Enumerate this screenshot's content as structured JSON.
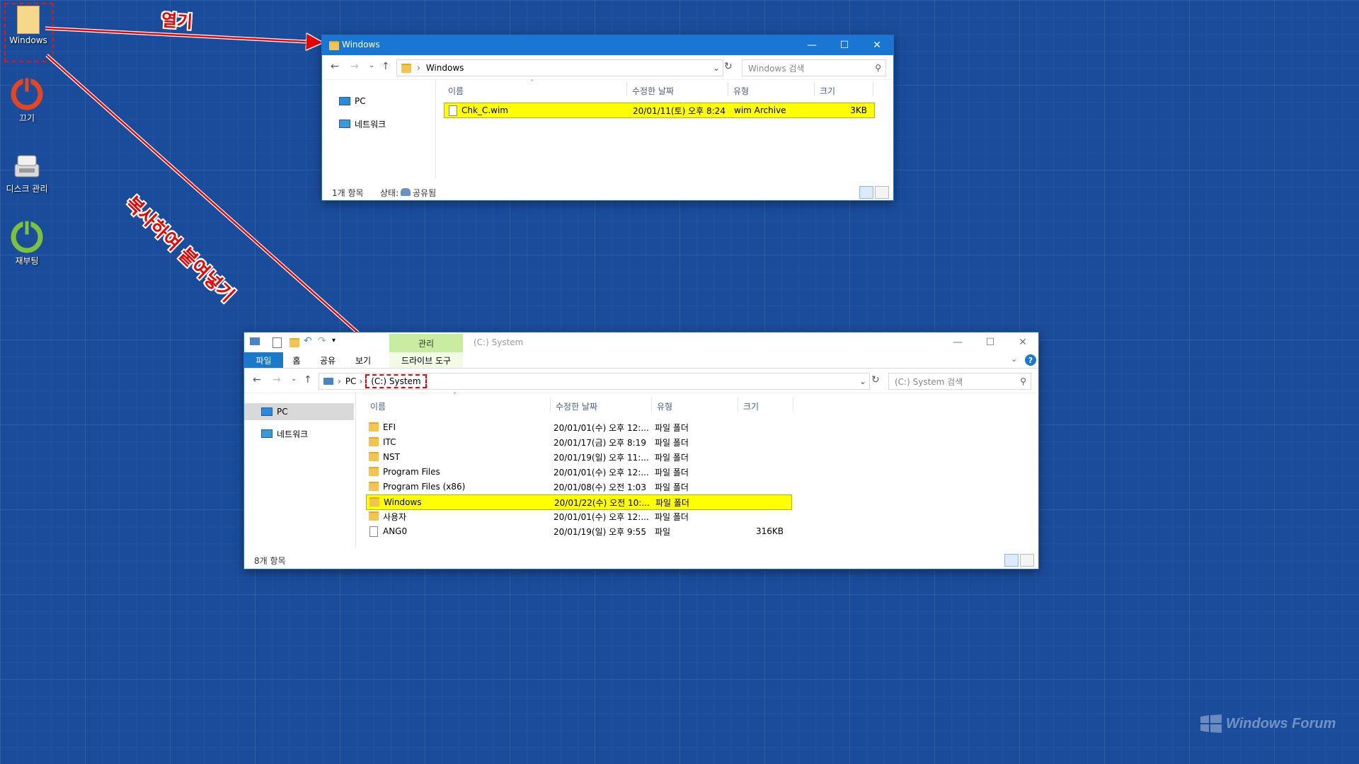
{
  "desktop": {
    "icons": [
      {
        "label": "Windows",
        "icon": "folder-icon"
      },
      {
        "label": "끄기",
        "icon": "power-icon"
      },
      {
        "label": "디스크 관리",
        "icon": "disk-management-icon"
      },
      {
        "label": "재부팅",
        "icon": "restart-icon"
      }
    ],
    "annotations": {
      "open": "열기",
      "copy_paste": "복사하여 붙여넣기"
    },
    "watermark": "Windows Forum",
    "colors": {
      "annotation": "#e00000",
      "highlight": "#ffff00",
      "titlebar": "#1976d2"
    }
  },
  "window1": {
    "title": "Windows",
    "address": {
      "path": "Windows"
    },
    "search_placeholder": "Windows 검색",
    "nav": [
      {
        "label": "PC",
        "icon": "pc-icon"
      },
      {
        "label": "네트워크",
        "icon": "network-icon"
      }
    ],
    "columns": [
      "이름",
      "수정한 날짜",
      "유형",
      "크기"
    ],
    "rows": [
      {
        "name": "Chk_C.wim",
        "date": "20/01/11(토) 오후 8:24",
        "type": "wim Archive",
        "size": "3KB",
        "highlighted": true
      }
    ],
    "status_count": "1개 항목",
    "status_state_label": "상태:",
    "status_state_value": "공유됨"
  },
  "window2": {
    "title": "(C:) System",
    "ribbon": {
      "context_group": "관리",
      "tabs": [
        "파일",
        "홈",
        "공유",
        "보기",
        "드라이브 도구"
      ]
    },
    "address": {
      "segments": [
        "PC",
        "(C:) System"
      ]
    },
    "search_placeholder": "(C:) System 검색",
    "nav": [
      {
        "label": "PC",
        "icon": "pc-icon"
      },
      {
        "label": "네트워크",
        "icon": "network-icon"
      }
    ],
    "columns": [
      "이름",
      "수정한 날짜",
      "유형",
      "크기"
    ],
    "rows": [
      {
        "name": "EFI",
        "date": "20/01/01(수) 오후 12:...",
        "type": "파일 폴더",
        "size": "",
        "icon": "folder"
      },
      {
        "name": "ITC",
        "date": "20/01/17(금) 오후 8:19",
        "type": "파일 폴더",
        "size": "",
        "icon": "folder"
      },
      {
        "name": "NST",
        "date": "20/01/19(일) 오후 11:...",
        "type": "파일 폴더",
        "size": "",
        "icon": "folder"
      },
      {
        "name": "Program Files",
        "date": "20/01/01(수) 오후 12:...",
        "type": "파일 폴더",
        "size": "",
        "icon": "folder"
      },
      {
        "name": "Program Files (x86)",
        "date": "20/01/08(수) 오전 1:03",
        "type": "파일 폴더",
        "size": "",
        "icon": "folder"
      },
      {
        "name": "Windows",
        "date": "20/01/22(수) 오전 10:...",
        "type": "파일 폴더",
        "size": "",
        "icon": "folder",
        "highlighted": true
      },
      {
        "name": "사용자",
        "date": "20/01/01(수) 오후 12:...",
        "type": "파일 폴더",
        "size": "",
        "icon": "folder"
      },
      {
        "name": "ANG0",
        "date": "20/01/19(일) 오후 9:55",
        "type": "파일",
        "size": "316KB",
        "icon": "file"
      }
    ],
    "status_count": "8개 항목"
  }
}
